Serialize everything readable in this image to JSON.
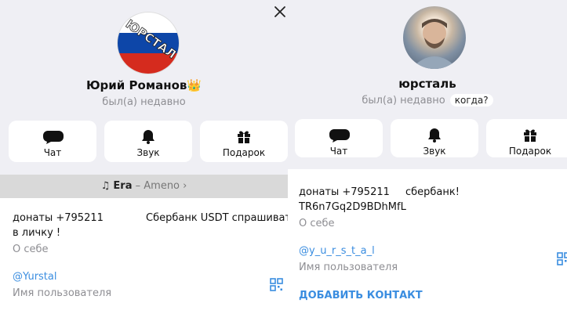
{
  "left_profile": {
    "avatar_text": "ЮРСТАЛ",
    "name": "Юрий Романов",
    "crown_emoji": "👑",
    "status": "был(а) недавно",
    "actions": [
      "Чат",
      "Звук",
      "Подарок"
    ],
    "music": {
      "note": "♫",
      "song": "Era",
      "separator": " – ",
      "artist": "Ameno",
      "chevron": "›"
    },
    "bio_line1_a": "донаты +795211",
    "bio_line1_b": "Сбербанк USDT спрашивать",
    "bio_line2": "в личку !",
    "bio_caption": "О себе",
    "username": "@Yurstal",
    "username_caption": "Имя пользователя"
  },
  "right_profile": {
    "name": "юрсталь",
    "status": "был(а) недавно",
    "when_button": "когда?",
    "actions": [
      "Чат",
      "Звук",
      "Подарок"
    ],
    "bio_line1_a": "донаты +795211",
    "bio_line1_b": "сбербанк!",
    "bio_line2": "TR6n7Gq2D9BDhMfL",
    "bio_caption": "О себе",
    "username": "@y_u_r_s_t_a_l",
    "username_caption": "Имя пользователя",
    "add_contact": "ДОБАВИТЬ КОНТАКТ"
  },
  "colors": {
    "accent": "#3a8de0",
    "header_bg": "#efeff4",
    "muted": "#8e8e93",
    "music_bg": "#d9d9d9"
  },
  "icons": [
    "chat-bubble-icon",
    "bell-icon",
    "gift-icon",
    "qr-code-icon",
    "close-icon",
    "music-note-icon",
    "chevron-right-icon"
  ]
}
